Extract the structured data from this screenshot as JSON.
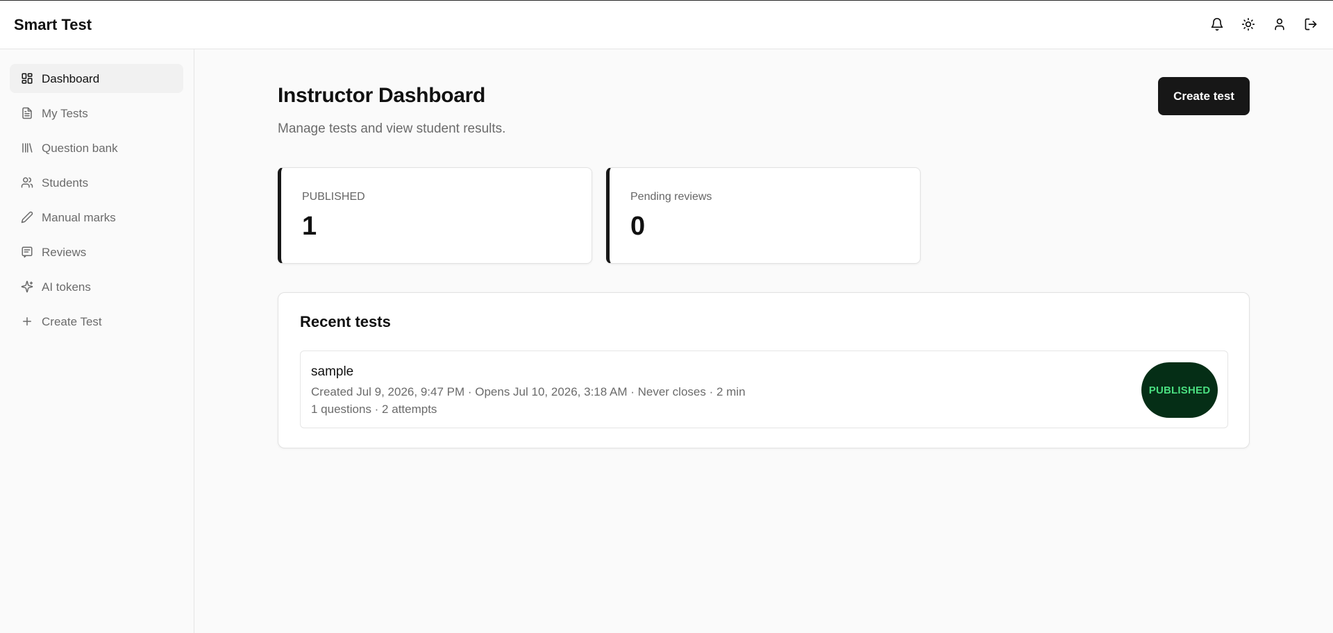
{
  "app": {
    "title": "Smart Test"
  },
  "topbar": {
    "icons": [
      "bell-icon",
      "sun-icon",
      "user-icon",
      "logout-icon"
    ]
  },
  "sidebar": {
    "items": [
      {
        "label": "Dashboard",
        "icon": "dashboard-icon",
        "active": true
      },
      {
        "label": "My Tests",
        "icon": "document-icon"
      },
      {
        "label": "Question bank",
        "icon": "library-icon"
      },
      {
        "label": "Students",
        "icon": "users-icon"
      },
      {
        "label": "Manual marks",
        "icon": "pencil-icon"
      },
      {
        "label": "Reviews",
        "icon": "message-icon"
      },
      {
        "label": "AI tokens",
        "icon": "sparkles-icon"
      },
      {
        "label": "Create Test",
        "icon": "plus-icon"
      }
    ]
  },
  "header": {
    "title": "Instructor Dashboard",
    "subtitle": "Manage tests and view student results.",
    "create_label": "Create test"
  },
  "stats": [
    {
      "label": "PUBLISHED",
      "value": "1"
    },
    {
      "label": "Pending reviews",
      "value": "0"
    }
  ],
  "recent": {
    "title": "Recent tests",
    "items": [
      {
        "name": "sample",
        "meta": "Created Jul 9, 2026, 9:47 PM · Opens Jul 10, 2026, 3:18 AM · Never closes · 2 min",
        "meta2": "1 questions · 2 attempts",
        "status": "PUBLISHED"
      }
    ]
  },
  "colors": {
    "accent": "#171717",
    "badge_bg": "#052e16",
    "badge_text": "#4ade80",
    "page_bg": "#fafafa"
  }
}
